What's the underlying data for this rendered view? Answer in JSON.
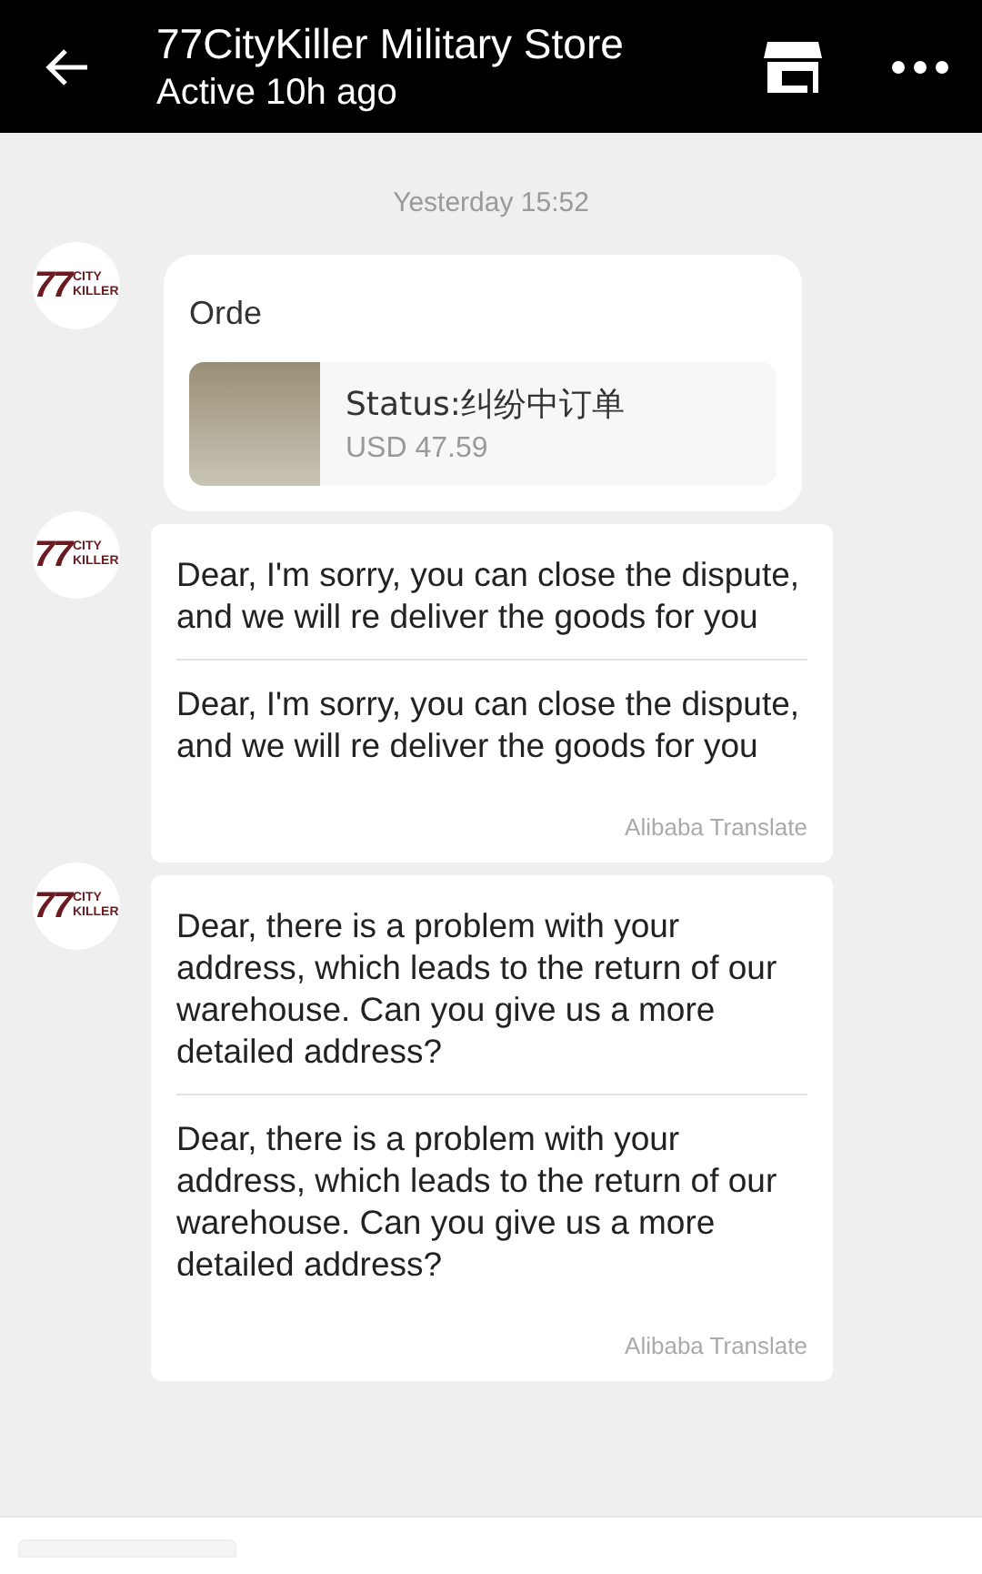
{
  "header": {
    "title": "77CityKiller Military Store",
    "subtitle": "Active 10h ago"
  },
  "timestamp": "Yesterday 15:52",
  "messages": [
    {
      "kind": "order",
      "avatar": {
        "number": "77",
        "top": "CITY",
        "bottom": "KILLER"
      },
      "title": "Orde",
      "status": "Status:纠纷中订单",
      "price": "USD 47.59"
    },
    {
      "kind": "translated",
      "avatar": {
        "number": "77",
        "top": "CITY",
        "bottom": "KILLER"
      },
      "original": "Dear, I'm sorry, you can close the dispute, and we will re deliver the goods for you",
      "translation": "Dear, I'm sorry, you can close the dispute, and we will re deliver the goods for you",
      "source": "Alibaba Translate"
    },
    {
      "kind": "translated",
      "avatar": {
        "number": "77",
        "top": "CITY",
        "bottom": "KILLER"
      },
      "original": "Dear, there is a problem with your address, which leads to the return of our warehouse. Can you give us a more detailed address?",
      "translation": "Dear, there is a problem with your address, which leads to the return of our warehouse. Can you give us a more detailed address?",
      "source": "Alibaba Translate"
    }
  ]
}
